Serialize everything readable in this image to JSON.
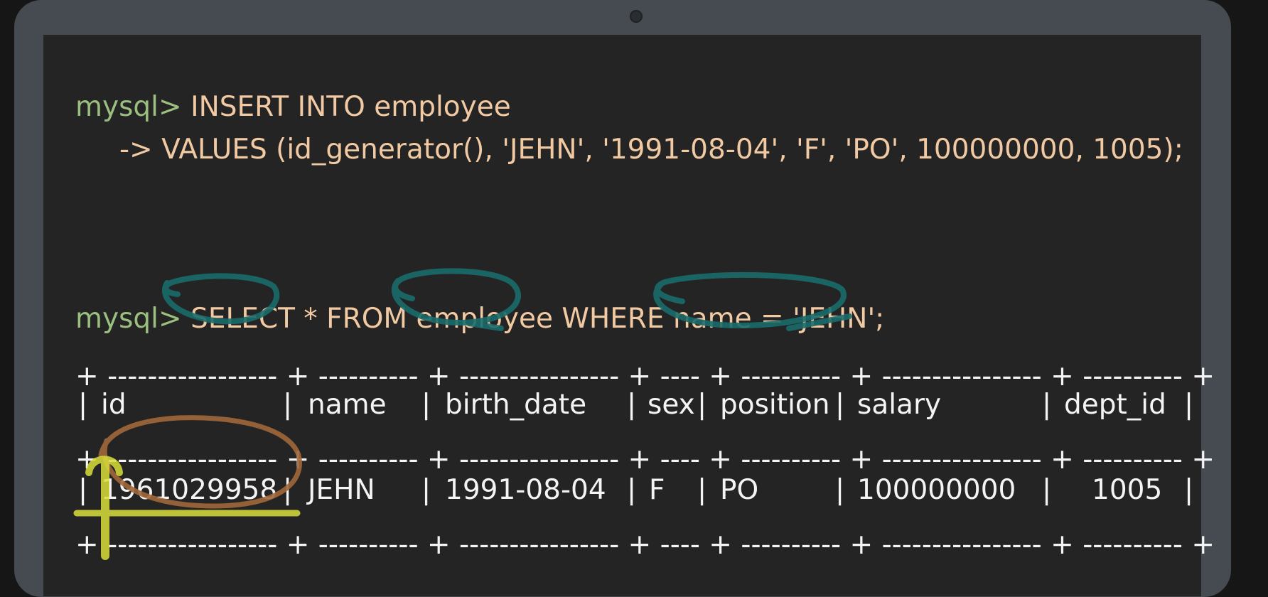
{
  "terminal": {
    "insert_prompt": "mysql>",
    "insert_line1": " INSERT INTO employee",
    "insert_line2": "     -> VALUES (id_generator(), 'JEHN', '1991-08-04', 'F', 'PO', 100000000, 1005);",
    "select_prompt": "mysql>",
    "select_line": " SELECT * FROM employee WHERE name = 'JEHN';"
  },
  "result_table": {
    "columns": [
      "id",
      "name",
      "birth_date",
      "sex",
      "position",
      "salary",
      "dept_id"
    ],
    "rows": [
      [
        "1961029958",
        "JEHN",
        "1991-08-04",
        "F",
        "PO",
        "100000000",
        "1005"
      ]
    ]
  },
  "annotations": {
    "teal_color": "#1a6b6b",
    "orange_color": "#a0673a",
    "yellow_color": "#d8de3a"
  }
}
